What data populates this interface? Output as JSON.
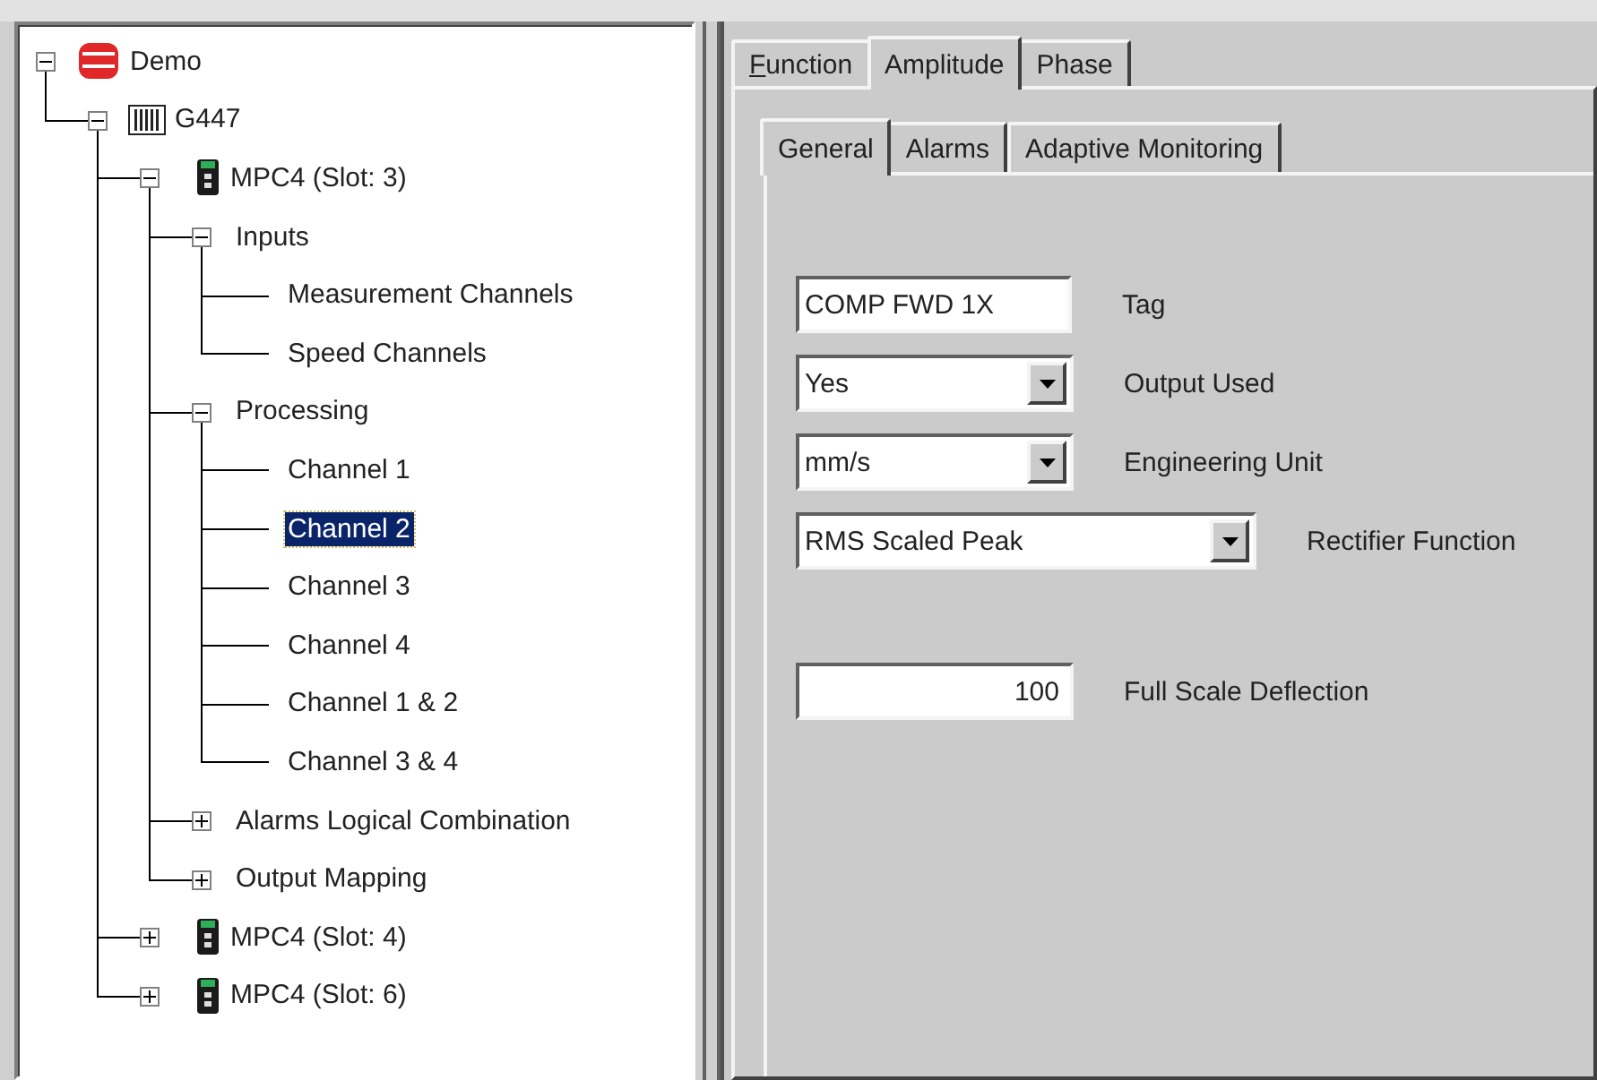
{
  "tree": [
    {
      "label": "Demo",
      "kind": "database",
      "expanded": true,
      "selected": false,
      "children": [
        {
          "label": "G447",
          "kind": "rack",
          "expanded": true,
          "selected": false,
          "children": [
            {
              "label": "MPC4 (Slot:  3)",
              "kind": "module",
              "expanded": true,
              "selected": false,
              "children": [
                {
                  "label": "Inputs",
                  "expanded": true,
                  "selected": false,
                  "children": [
                    {
                      "label": "Measurement Channels",
                      "selected": false
                    },
                    {
                      "label": "Speed Channels",
                      "selected": false
                    }
                  ]
                },
                {
                  "label": "Processing",
                  "expanded": true,
                  "selected": false,
                  "children": [
                    {
                      "label": "Channel 1",
                      "selected": false
                    },
                    {
                      "label": "Channel 2",
                      "selected": true
                    },
                    {
                      "label": "Channel 3",
                      "selected": false
                    },
                    {
                      "label": "Channel 4",
                      "selected": false
                    },
                    {
                      "label": "Channel 1 & 2",
                      "selected": false
                    },
                    {
                      "label": "Channel 3 & 4",
                      "selected": false
                    }
                  ]
                },
                {
                  "label": "Alarms Logical Combination",
                  "expanded": false,
                  "selected": false
                },
                {
                  "label": "Output Mapping",
                  "expanded": false,
                  "selected": false
                }
              ]
            },
            {
              "label": "MPC4 (Slot:  4)",
              "kind": "module",
              "expanded": false,
              "selected": false
            },
            {
              "label": "MPC4 (Slot:  6)",
              "kind": "module",
              "expanded": false,
              "selected": false
            }
          ]
        }
      ]
    }
  ],
  "tabs": [
    {
      "label": "Function",
      "access_key": true,
      "selected": false
    },
    {
      "label": "Amplitude",
      "access_key": false,
      "selected": true
    },
    {
      "label": "Phase",
      "access_key": false,
      "selected": false
    }
  ],
  "subtabs": [
    {
      "label": "General",
      "selected": true
    },
    {
      "label": "Alarms",
      "selected": false
    },
    {
      "label": "Adaptive Monitoring",
      "selected": false
    }
  ],
  "field_groups": [
    [
      {
        "kind": "text",
        "value": "COMP FWD 1X",
        "label": "Tag"
      },
      {
        "kind": "select",
        "value": "Yes",
        "label": "Output Used"
      },
      {
        "kind": "select",
        "value": "mm/s",
        "label": "Engineering Unit"
      },
      {
        "kind": "wide-select",
        "value": "RMS Scaled Peak",
        "label": "Rectifier Function"
      }
    ],
    [
      {
        "kind": "number",
        "value": "100",
        "label": "Full Scale Deflection"
      }
    ]
  ]
}
